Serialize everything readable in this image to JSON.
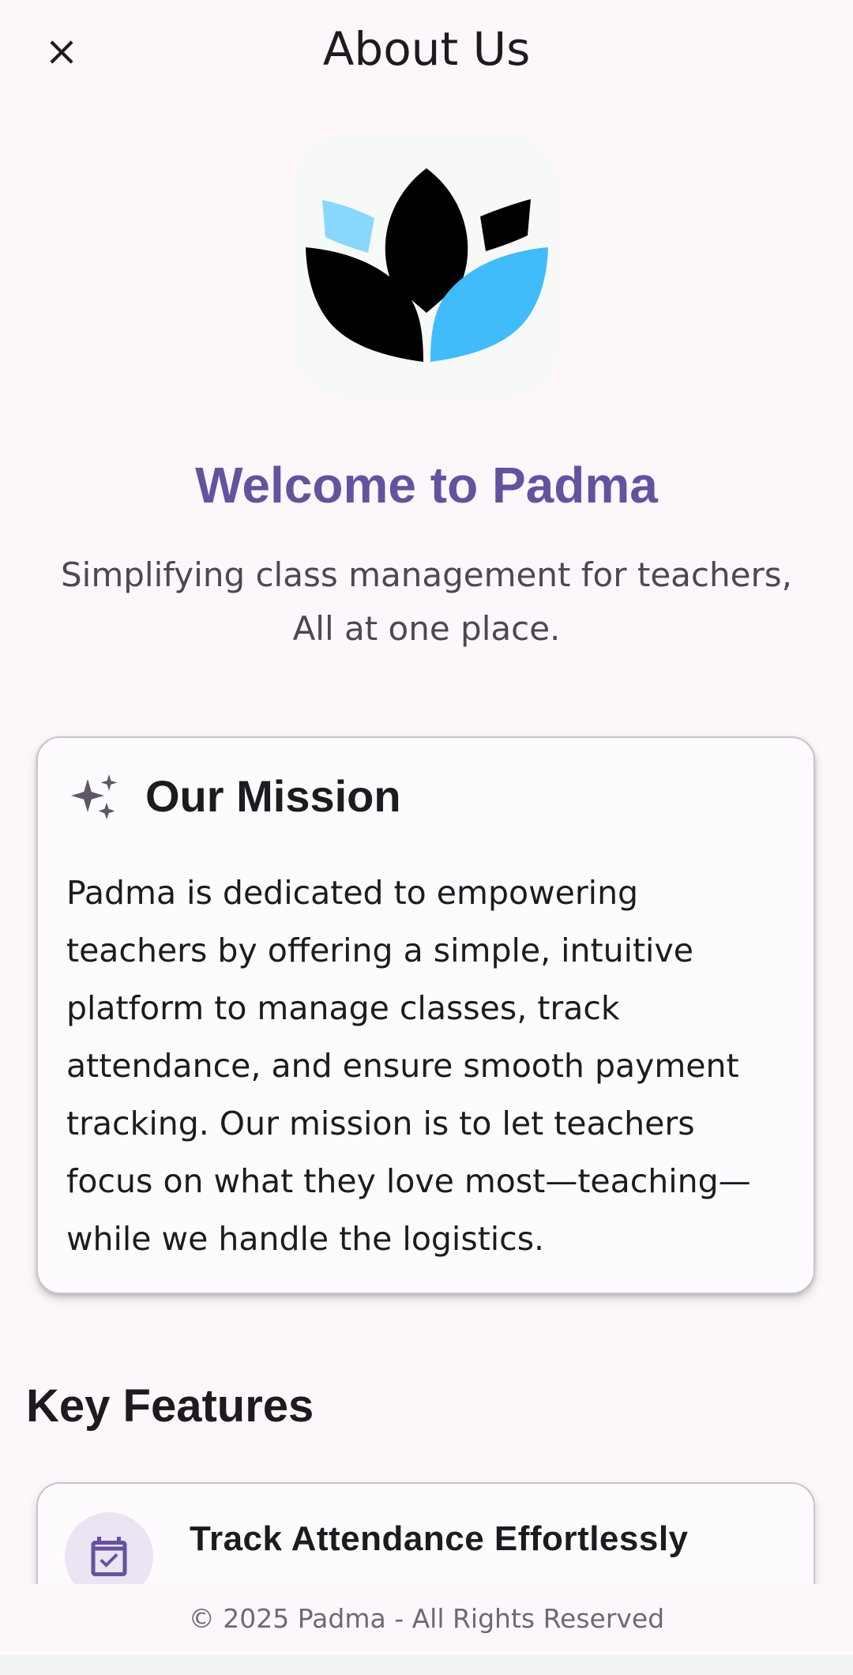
{
  "header": {
    "title": "About Us",
    "close_icon": "close-icon"
  },
  "hero": {
    "logo": "lotus-logo",
    "colors": {
      "dark_petal": "#000000",
      "light_blue": "#40bcfa",
      "pale_blue": "#8ad7fd"
    },
    "welcome": "Welcome to Padma",
    "tagline_lines": [
      "Simplifying class management for teachers,",
      "All at one place."
    ]
  },
  "mission": {
    "icon": "sparkle-icon",
    "title": "Our Mission",
    "lines": [
      "Padma is dedicated to empowering",
      "teachers by offering a simple, intuitive",
      "platform to manage classes, track",
      "attendance, and ensure smooth payment",
      "tracking. Our mission is to let teachers",
      "focus on what they love most—teaching—",
      "while we handle the logistics."
    ]
  },
  "features": {
    "heading": "Key Features",
    "items": [
      {
        "icon": "calendar-check-icon",
        "title": "Track Attendance Effortlessly"
      }
    ]
  },
  "footer": {
    "text": "© 2025 Padma - All Rights Reserved"
  },
  "theme": {
    "accent": "#65529e",
    "background": "#fdf7fc"
  }
}
